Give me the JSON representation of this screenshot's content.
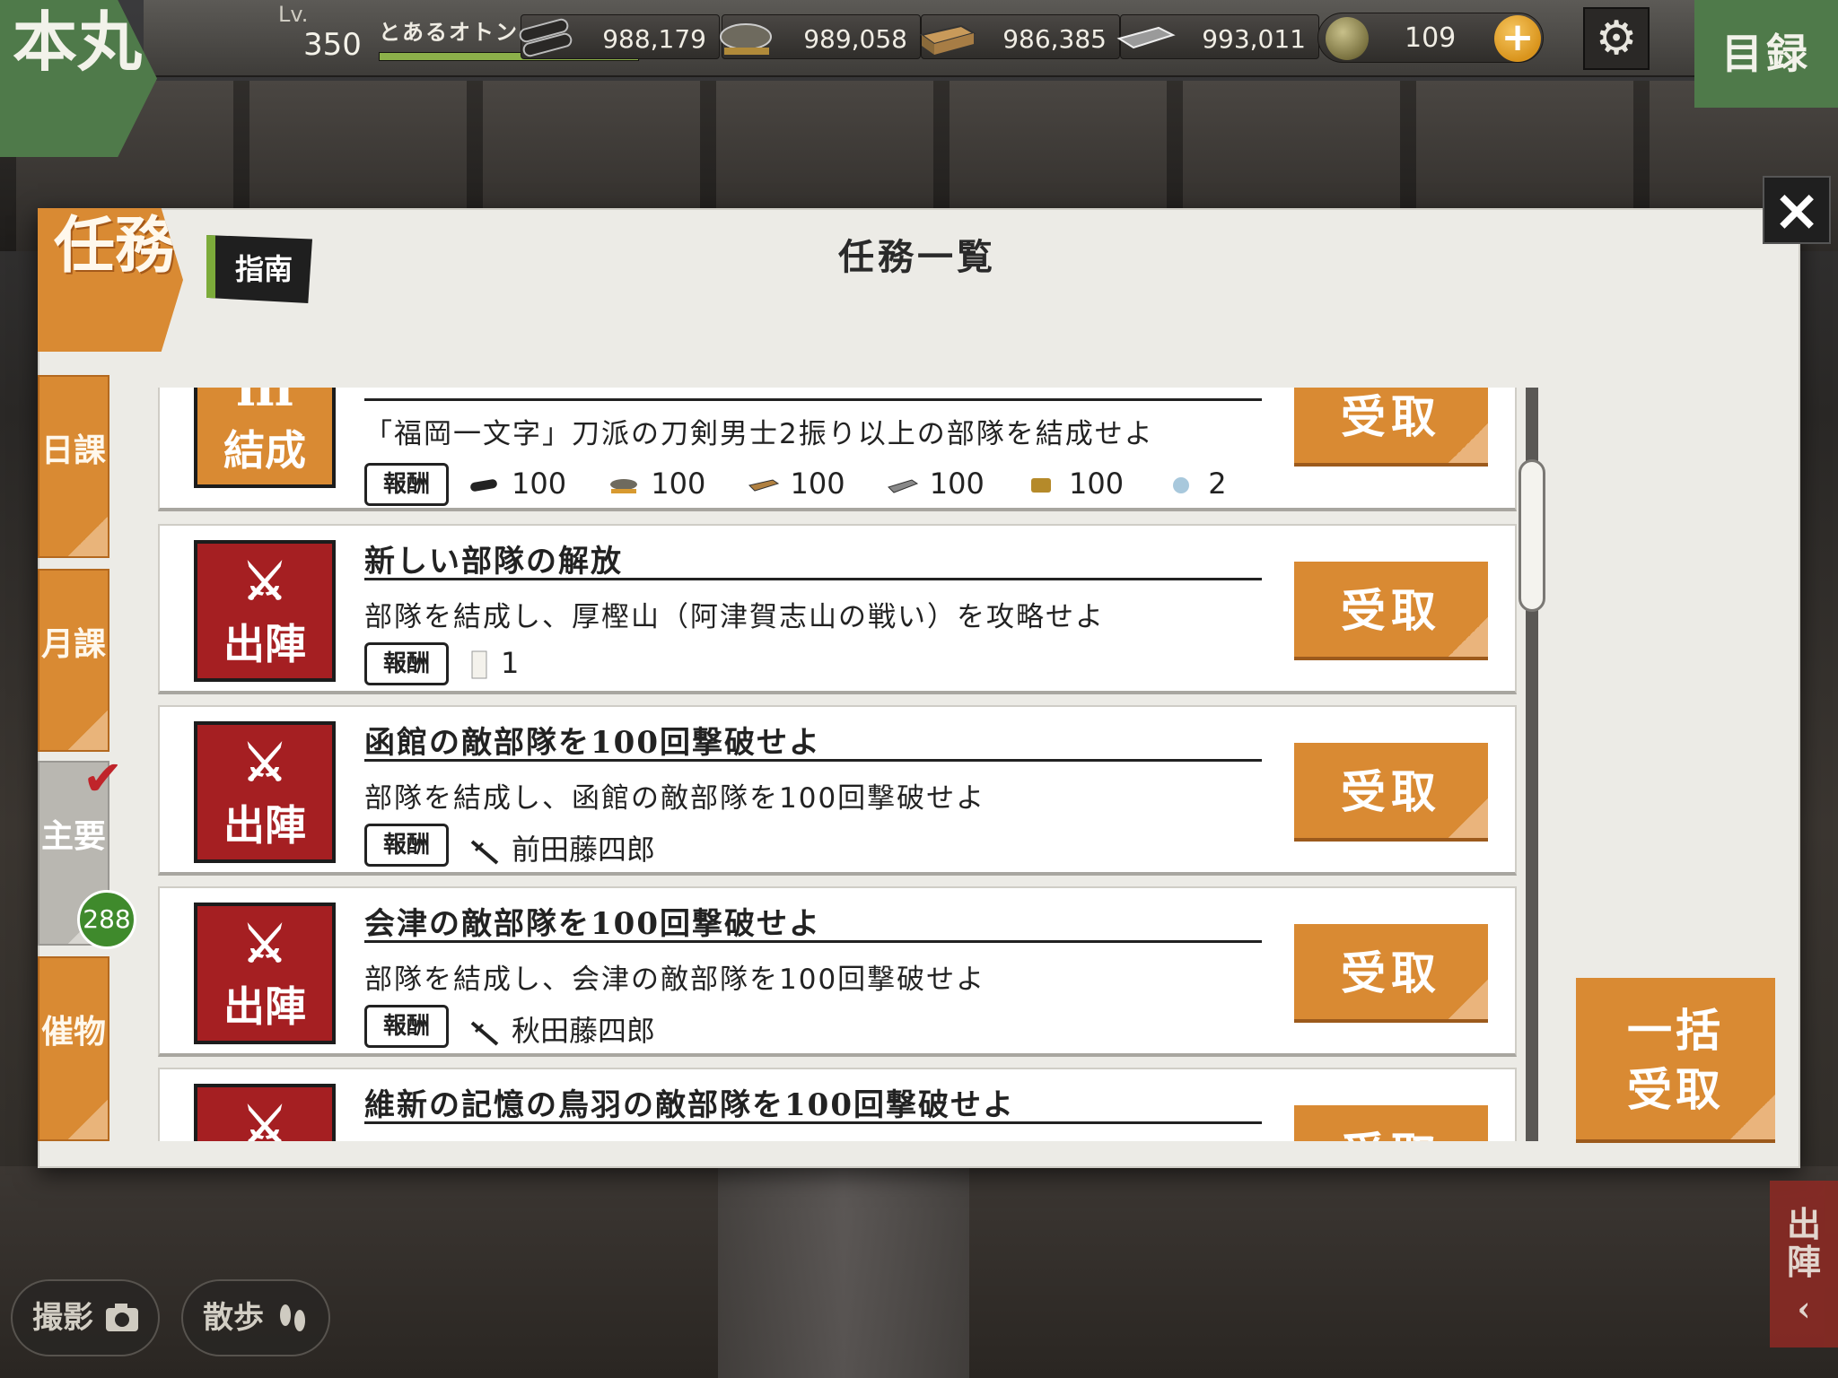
{
  "header": {
    "home_label": "本丸",
    "level_label": "Lv.",
    "level_value": "350",
    "player_name": "とあるオトンの刀剣乱舞",
    "exp_ratio": 1.0,
    "resources": [
      {
        "icon": "charcoal-icon",
        "value": "988,179"
      },
      {
        "icon": "cooling-water-icon",
        "value": "989,058"
      },
      {
        "icon": "whetstone-icon",
        "value": "986,385"
      },
      {
        "icon": "steel-icon",
        "value": "993,011"
      }
    ],
    "coin": {
      "value": "109",
      "plus_label": "+"
    },
    "settings_icon": "gear-icon",
    "catalog_label": "目録"
  },
  "dialog": {
    "section_tag": "任務",
    "guide_label": "指南",
    "title": "任務一覧",
    "close_label": "×",
    "tabs": [
      {
        "label": "日課"
      },
      {
        "label": "月課"
      },
      {
        "label": "主要",
        "badge": "288"
      },
      {
        "label": "催物"
      }
    ],
    "reward_label": "報酬",
    "claim_label": "受取",
    "bulk_claim_label": "一括受取",
    "quests": [
      {
        "icon_label": "結成",
        "icon_kind": "formation",
        "title": "",
        "description": "「福岡一文字」刀派の刀剣男士2振り以上の部隊を結成せよ",
        "rewards": [
          {
            "icon": "charcoal-icon",
            "text": "100"
          },
          {
            "icon": "cooling-water-icon",
            "text": "100"
          },
          {
            "icon": "whetstone-icon",
            "text": "100"
          },
          {
            "icon": "steel-icon",
            "text": "100"
          },
          {
            "icon": "koban-icon",
            "text": "100"
          },
          {
            "icon": "crystal-icon",
            "text": "2"
          }
        ]
      },
      {
        "icon_label": "出陣",
        "icon_kind": "sortie",
        "title": "新しい部隊の解放",
        "description": "部隊を結成し、厚樫山（阿津賀志山の戦い）を攻略せよ",
        "rewards": [
          {
            "icon": "permit-icon",
            "text": "1"
          }
        ]
      },
      {
        "icon_label": "出陣",
        "icon_kind": "sortie",
        "title": "函館の敵部隊を100回撃破せよ",
        "description": "部隊を結成し、函館の敵部隊を100回撃破せよ",
        "rewards": [
          {
            "icon": "sword-icon",
            "text": "前田藤四郎"
          }
        ]
      },
      {
        "icon_label": "出陣",
        "icon_kind": "sortie",
        "title": "会津の敵部隊を100回撃破せよ",
        "description": "部隊を結成し、会津の敵部隊を100回撃破せよ",
        "rewards": [
          {
            "icon": "sword-icon",
            "text": "秋田藤四郎"
          }
        ]
      },
      {
        "icon_label": "出陣",
        "icon_kind": "sortie",
        "title": "維新の記憶の鳥羽の敵部隊を100回撃破せよ",
        "description": "",
        "rewards": []
      }
    ]
  },
  "footer": {
    "photo_label": "撮影",
    "walk_label": "散歩",
    "sortie_label": "出陣"
  }
}
